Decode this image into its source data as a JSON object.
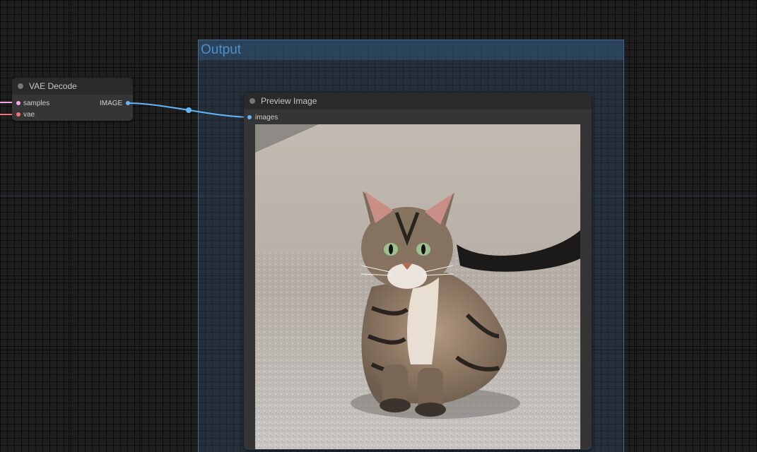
{
  "group": {
    "title": "Output",
    "color": "#4f8fc8"
  },
  "vae_decode": {
    "title": "VAE Decode",
    "inputs": [
      {
        "label": "samples",
        "color": "#f8a5e8"
      },
      {
        "label": "vae",
        "color": "#ff6e6e"
      }
    ],
    "output": {
      "label": "IMAGE",
      "color": "#64b5f6"
    }
  },
  "preview_image": {
    "title": "Preview Image",
    "input": {
      "label": "images",
      "color": "#64b5f6"
    },
    "image_subject": "tabby-cat-photo"
  },
  "link_color": "#64b5f6"
}
